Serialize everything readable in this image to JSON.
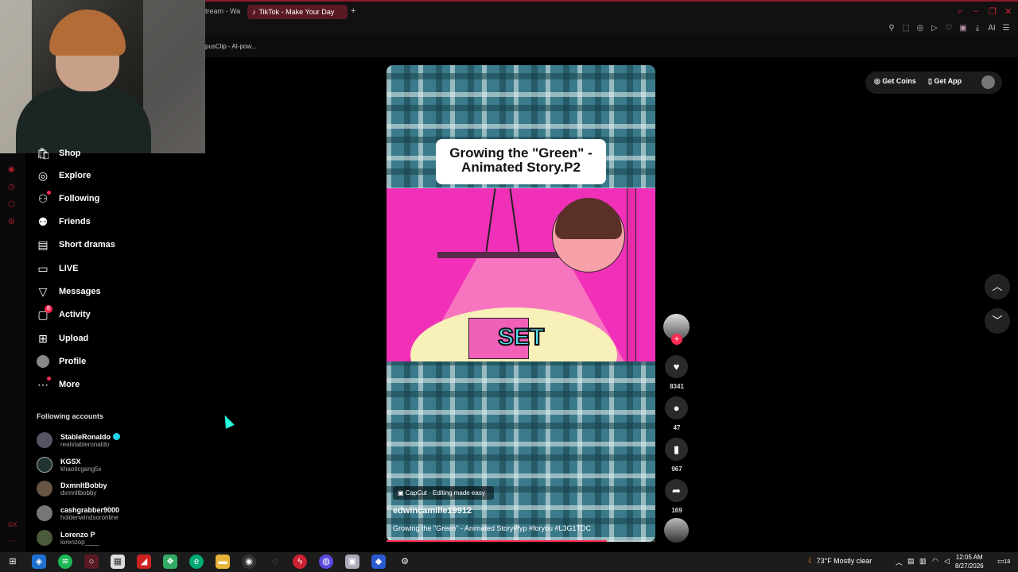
{
  "browser": {
    "prev_tab_label": "tream - Wa",
    "active_tab_label": "TikTok - Make Your Day",
    "bookmark_label": "pusClip - AI-pow..."
  },
  "toolbar_icons": [
    "pin-icon",
    "crop-icon",
    "camera-icon",
    "play-icon",
    "heart-icon",
    "extension-icon",
    "download-icon",
    "ai-icon",
    "menu-icon"
  ],
  "toolbar_ai_label": "AI",
  "sidebar": {
    "items": [
      {
        "label": "Shop",
        "icon": "shop-icon"
      },
      {
        "label": "Explore",
        "icon": "compass-icon"
      },
      {
        "label": "Following",
        "icon": "following-icon"
      },
      {
        "label": "Friends",
        "icon": "friends-icon"
      },
      {
        "label": "Short dramas",
        "icon": "film-icon"
      },
      {
        "label": "LIVE",
        "icon": "live-icon"
      },
      {
        "label": "Messages",
        "icon": "messages-icon"
      },
      {
        "label": "Activity",
        "icon": "activity-icon",
        "badge": "8"
      },
      {
        "label": "Upload",
        "icon": "upload-icon"
      },
      {
        "label": "Profile",
        "icon": "profile-icon"
      },
      {
        "label": "More",
        "icon": "more-icon"
      }
    ],
    "following_title": "Following accounts",
    "accounts": [
      {
        "name": "StableRonaldo",
        "handle": "realstableronaldo",
        "verified": true
      },
      {
        "name": "KGSX",
        "handle": "khaoticgang5x"
      },
      {
        "name": "DxmnltBobby",
        "handle": "dxmnltbobby"
      },
      {
        "name": "cashgrabber9000",
        "handle": "holdenwindsoronline"
      },
      {
        "name": "Lorenzo P",
        "handle": "lorenzop____"
      }
    ]
  },
  "header": {
    "get_coins": "Get Coins",
    "get_app": "Get App"
  },
  "video": {
    "title_card": "Growing the \"Green\" - Animated Story.P2",
    "overlay_text": "SET",
    "capcut_label": "CapCut · Editing made easy",
    "author": "edwincamille19912",
    "caption": "Growing the \"Green\" - Animated Story#fyp #foryou #L3G1TDC",
    "progress": 0.82
  },
  "actions": {
    "likes": "8341",
    "comments": "47",
    "saves": "967",
    "shares": "169"
  },
  "taskbar": {
    "weather": "73°F  Mostly clear",
    "time": "12:05 AM",
    "date": "8/27/2026",
    "notif_count": "18"
  }
}
